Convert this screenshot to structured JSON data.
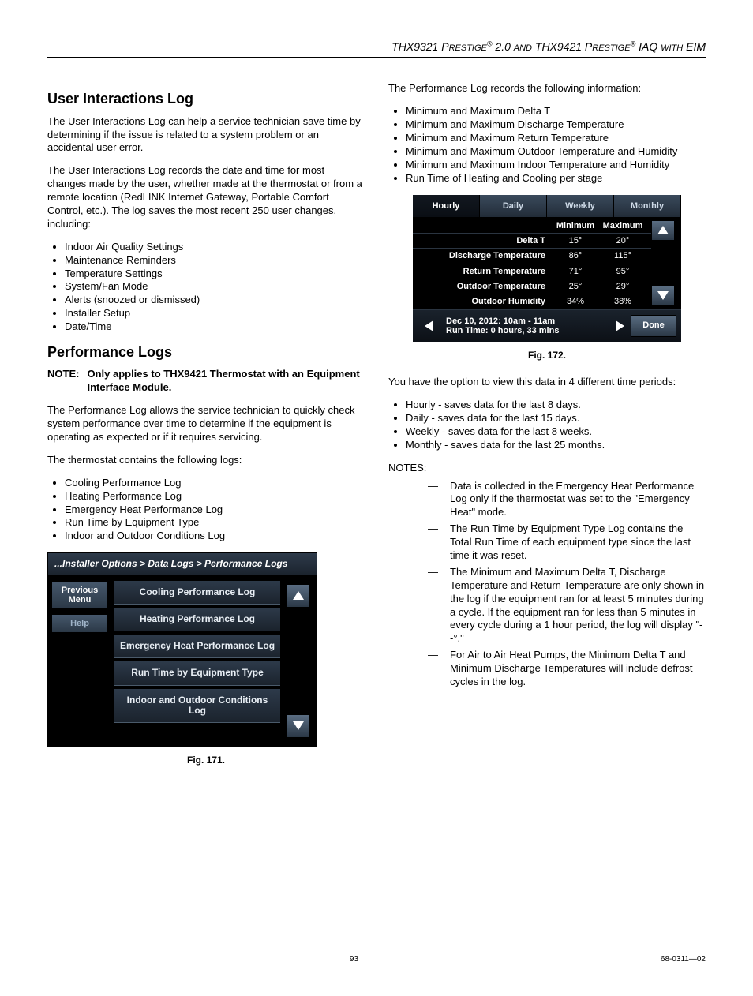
{
  "header": {
    "text_html": "THX9321 PRESTIGE 2.0 AND THX9421 PRESTIGE IAQ WITH EIM",
    "part1": "THX9321 P",
    "part2": "RESTIGE",
    "reg1": "®",
    "part3": " 2.0 ",
    "part4": "AND",
    "part5": " THX9421 P",
    "part6": "RESTIGE",
    "reg2": "®",
    "part7": " IAQ ",
    "part8": "WITH",
    "part9": " EIM"
  },
  "left": {
    "h_user": "User Interactions Log",
    "p1": "The User Interactions Log can help a service technician save time by determining if the issue is related to a system problem or an accidental user error.",
    "p2": "The User Interactions Log records the date and time for most changes made by the user, whether made at the thermostat or from a remote location (RedLINK Internet Gateway, Portable Comfort Control, etc.). The log saves the most recent 250 user changes, including:",
    "user_bullets": [
      "Indoor Air Quality Settings",
      "Maintenance Reminders",
      "Temperature Settings",
      "System/Fan Mode",
      "Alerts (snoozed or dismissed)",
      "Installer Setup",
      "Date/Time"
    ],
    "h_perf": "Performance Logs",
    "note_lbl": "NOTE:",
    "note_txt": "Only applies to THX9421 Thermostat with an Equipment Interface Module.",
    "p3": "The Performance Log allows the service technician to quickly check system performance over time to determine if the equipment is operating as expected or if it requires servicing.",
    "p4": "The thermostat contains the following logs:",
    "log_bullets": [
      "Cooling Performance Log",
      "Heating Performance Log",
      "Emergency Heat Performance Log",
      "Run Time by Equipment Type",
      "Indoor and Outdoor Conditions Log"
    ],
    "fig171_cap": "Fig. 171."
  },
  "ui171": {
    "crumb": "...Installer Options > Data Logs > Performance Logs",
    "side_prev": "Previous Menu",
    "side_help": "Help",
    "items": [
      "Cooling Performance Log",
      "Heating Performance Log",
      "Emergency Heat Performance Log",
      "Run Time by Equipment Type",
      "Indoor and Outdoor Conditions Log"
    ]
  },
  "right": {
    "p_intro": "The Performance Log records the following information:",
    "rec_bullets": [
      "Minimum and Maximum Delta T",
      "Minimum and Maximum Discharge Temperature",
      "Minimum and Maximum Return Temperature",
      "Minimum and Maximum Outdoor Temperature and Humidity",
      "Minimum and Maximum Indoor Temperature and Humidity",
      "Run Time of Heating and Cooling per stage"
    ],
    "fig172_cap": "Fig. 172.",
    "p_opts": "You have the option to view this data in 4 different time periods:",
    "period_bullets": [
      "Hourly - saves data for the last 8 days.",
      "Daily - saves data for the last 15 days.",
      "Weekly - saves data for the last 8 weeks.",
      "Monthly - saves data for the last 25 months."
    ],
    "notes_head": "NOTES:",
    "notes_items": [
      "Data is collected in the Emergency Heat Performance Log only if the thermostat was set to the \"Emergency Heat\" mode.",
      "The Run Time by Equipment Type Log contains the Total Run Time of each equipment type since the last time it was reset.",
      "The Minimum and Maximum Delta T, Discharge Temperature and Return Temperature are only shown in the log if the equipment ran for at least 5 minutes during a cycle. If the equipment ran for less than 5 minutes in every cycle during a 1 hour period, the log will display \"--°.\"",
      "For Air to Air Heat Pumps, the Minimum Delta T and Minimum Discharge Temperatures will include defrost cycles in the log."
    ]
  },
  "ui172": {
    "tabs": [
      "Hourly",
      "Daily",
      "Weekly",
      "Monthly"
    ],
    "active_tab": "Hourly",
    "col_min": "Minimum",
    "col_max": "Maximum",
    "rows": [
      {
        "label": "Delta T",
        "min": "15°",
        "max": "20°"
      },
      {
        "label": "Discharge Temperature",
        "min": "86°",
        "max": "115°"
      },
      {
        "label": "Return Temperature",
        "min": "71°",
        "max": "95°"
      },
      {
        "label": "Outdoor Temperature",
        "min": "25°",
        "max": "29°"
      },
      {
        "label": "Outdoor Humidity",
        "min": "34%",
        "max": "38%"
      }
    ],
    "foot_line1": "Dec 10, 2012: 10am - 11am",
    "foot_line2": "Run Time: 0 hours, 33 mins",
    "done": "Done"
  },
  "footer": {
    "page": "93",
    "doc": "68-0311—02"
  },
  "chart_data": {
    "type": "table",
    "title": "Hourly Performance Log",
    "columns": [
      "Metric",
      "Minimum",
      "Maximum"
    ],
    "rows": [
      [
        "Delta T",
        "15°",
        "20°"
      ],
      [
        "Discharge Temperature",
        "86°",
        "115°"
      ],
      [
        "Return Temperature",
        "71°",
        "95°"
      ],
      [
        "Outdoor Temperature",
        "25°",
        "29°"
      ],
      [
        "Outdoor Humidity",
        "34%",
        "38%"
      ]
    ],
    "timestamp": "Dec 10, 2012: 10am - 11am",
    "run_time": "0 hours, 33 mins"
  }
}
